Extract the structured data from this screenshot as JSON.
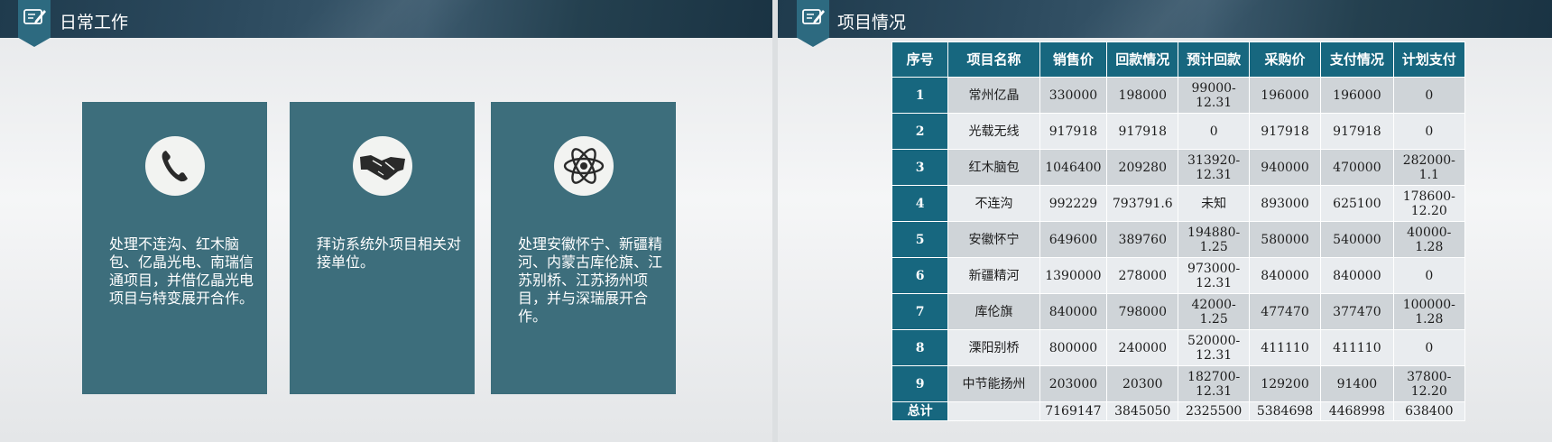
{
  "left_slide": {
    "title": "日常工作",
    "cards": [
      {
        "icon": "phone-icon",
        "text": "处理不连沟、红木脑包、亿晶光电、南瑞信通项目，并借亿晶光电项目与特变展开合作。"
      },
      {
        "icon": "handshake-icon",
        "text": "拜访系统外项目相关对接单位。"
      },
      {
        "icon": "atom-icon",
        "text": "处理安徽怀宁、新疆精河、内蒙古库伦旗、江苏别桥、江苏扬州项目，并与深瑞展开合作。"
      }
    ]
  },
  "right_slide": {
    "title": "项目情况",
    "headers": [
      "序号",
      "项目名称",
      "销售价",
      "回款情况",
      "预计回款",
      "采购价",
      "支付情况",
      "计划支付"
    ],
    "rows": [
      [
        "1",
        "常州亿晶",
        "330000",
        "198000",
        "99000-12.31",
        "196000",
        "196000",
        "0"
      ],
      [
        "2",
        "光载无线",
        "917918",
        "917918",
        "0",
        "917918",
        "917918",
        "0"
      ],
      [
        "3",
        "红木脑包",
        "1046400",
        "209280",
        "313920-12.31",
        "940000",
        "470000",
        "282000-1.1"
      ],
      [
        "4",
        "不连沟",
        "992229",
        "793791.6",
        "未知",
        "893000",
        "625100",
        "178600-12.20"
      ],
      [
        "5",
        "安徽怀宁",
        "649600",
        "389760",
        "194880-1.25",
        "580000",
        "540000",
        "40000-1.28"
      ],
      [
        "6",
        "新疆精河",
        "1390000",
        "278000",
        "973000-12.31",
        "840000",
        "840000",
        "0"
      ],
      [
        "7",
        "库伦旗",
        "840000",
        "798000",
        "42000-1.25",
        "477470",
        "377470",
        "100000-1.28"
      ],
      [
        "8",
        "溧阳别桥",
        "800000",
        "240000",
        "520000-12.31",
        "411110",
        "411110",
        "0"
      ],
      [
        "9",
        "中节能扬州",
        "203000",
        "20300",
        "182700-12.31",
        "129200",
        "91400",
        "37800-12.20"
      ]
    ],
    "total": [
      "总计",
      "",
      "7169147",
      "3845050",
      "2325500",
      "5384698",
      "4468998",
      "638400"
    ]
  },
  "colors": {
    "card": "#3d6e7c",
    "table_header": "#17677f",
    "row_alt": "#cfd4d8",
    "row_plain": "#e9ecef"
  }
}
